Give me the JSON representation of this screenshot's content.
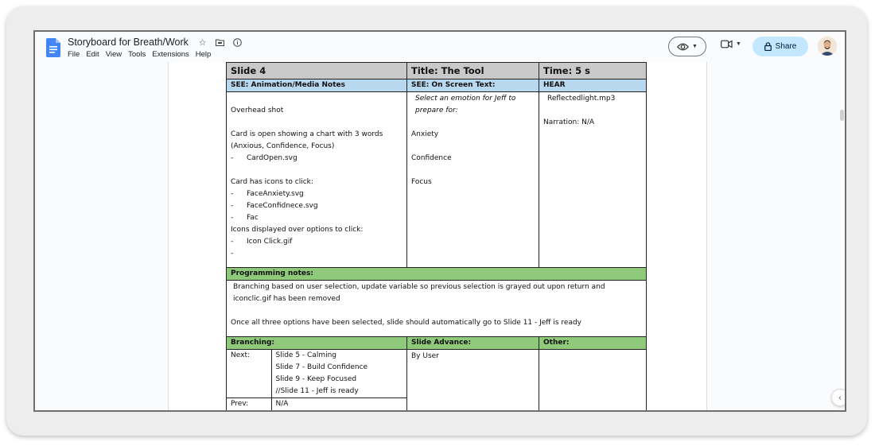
{
  "app": {
    "doc_title": "Storyboard for Breath/Work",
    "menu": [
      "File",
      "Edit",
      "View",
      "Tools",
      "Extensions",
      "Help"
    ],
    "share_label": "Share",
    "accent": "#c2e7ff",
    "icons": [
      "docs-icon",
      "star-icon",
      "folder-icon",
      "info-icon",
      "eye-icon",
      "meet-icon",
      "lock-icon",
      "avatar"
    ]
  },
  "storyboard": {
    "slide": "Slide 4",
    "title": "Title: The Tool",
    "time": "Time:  5 s",
    "see_media_header": "SEE: Animation/Media Notes",
    "see_text_header": "SEE: On Screen Text:",
    "hear_header": "HEAR",
    "media_notes": {
      "line1": "Overhead shot",
      "line2": "Card is open showing a chart with 3 words (Anxious, Confidence, Focus)",
      "b1": "CardOpen.svg",
      "line3": "Card has icons to click:",
      "b2": "FaceAnxiety.svg",
      "b3": "FaceConfidnece.svg",
      "b4": "Fac",
      "line4": "Icons displayed over options to click:",
      "b5": "Icon Click.gif",
      "b6": ""
    },
    "on_screen_text": {
      "prompt": "Select an emotion for Jeff to prepare for:",
      "opt1": "Anxiety",
      "opt2": "Confidence",
      "opt3": "Focus"
    },
    "hear": {
      "audio": "Reflectedlight.mp3",
      "narration": "Narration: N/A"
    },
    "programming_header": "Programming notes:",
    "programming": {
      "p1": "Branching based on user selection, update variable so previous selection is grayed out upon return and iconclic.gif has been removed",
      "p2": "Once all three options have been selected, slide should automatically go to Slide 11 - Jeff is ready"
    },
    "branching_header": "Branching:",
    "advance_header": "Slide Advance:",
    "other_header": "Other:",
    "branching": {
      "next_label": "Next:",
      "next": [
        "Slide 5 - Calming",
        "Slide 7 - Build Confidence",
        "Slide 9 - Keep Focused",
        "//Slide 11 - Jeff is ready"
      ],
      "prev_label": "Prev:",
      "prev": "N/A"
    },
    "advance": "By User",
    "other": ""
  }
}
